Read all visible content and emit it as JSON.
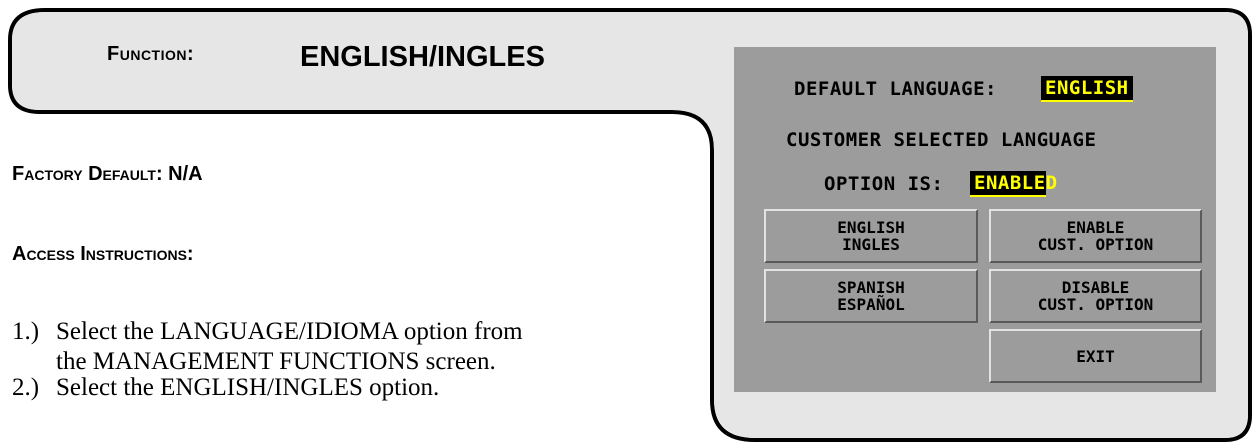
{
  "header": {
    "function_label": "Function:",
    "function_title": "ENGLISH/INGLES"
  },
  "body": {
    "factory_default": "Factory Default: N/A",
    "access_heading": "Access Instructions:",
    "steps": [
      {
        "num": "1.)",
        "lines": [
          "Select the LANGUAGE/IDIOMA option from",
          "the MANAGEMENT FUNCTIONS screen."
        ]
      },
      {
        "num": "2.)",
        "lines": [
          "Select the ENGLISH/INGLES option."
        ]
      }
    ]
  },
  "atm_screen": {
    "default_language_label": "DEFAULT LANGUAGE:",
    "default_language_value": "ENGLISH",
    "customer_line1": "CUSTOMER SELECTED LANGUAGE",
    "customer_line2": "OPTION IS:",
    "option_status": "ENABLED",
    "buttons": {
      "english": "ENGLISH\nINGLES",
      "spanish": "SPANISH\nESPAÑOL",
      "enable": "ENABLE\nCUST. OPTION",
      "disable": "DISABLE\nCUST. OPTION",
      "exit": "EXIT"
    },
    "colors": {
      "screen_bg": "#9c9c9c",
      "highlight_bg": "#000000",
      "highlight_fg": "#ffff00"
    }
  }
}
